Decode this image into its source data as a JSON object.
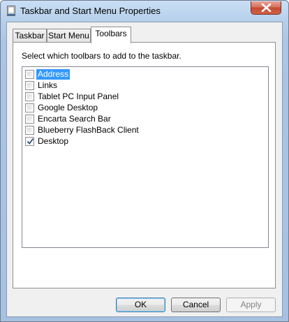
{
  "window": {
    "title": "Taskbar and Start Menu Properties",
    "title_icon": "taskbar-properties-icon",
    "close_icon": "close-icon",
    "close_color": "#c75050"
  },
  "tabs": [
    {
      "label": "Taskbar",
      "active": false
    },
    {
      "label": "Start Menu",
      "active": false
    },
    {
      "label": "Toolbars",
      "active": true
    }
  ],
  "toolbars_panel": {
    "instruction": "Select which toolbars to add to the taskbar.",
    "items": [
      {
        "label": "Address",
        "checked": false,
        "selected": true
      },
      {
        "label": "Links",
        "checked": false,
        "selected": false
      },
      {
        "label": "Tablet PC Input Panel",
        "checked": false,
        "selected": false
      },
      {
        "label": "Google Desktop",
        "checked": false,
        "selected": false
      },
      {
        "label": "Encarta Search Bar",
        "checked": false,
        "selected": false
      },
      {
        "label": "Blueberry FlashBack Client",
        "checked": false,
        "selected": false
      },
      {
        "label": "Desktop",
        "checked": true,
        "selected": false
      }
    ]
  },
  "buttons": {
    "ok": "OK",
    "cancel": "Cancel",
    "apply": "Apply",
    "apply_enabled": false
  },
  "colors": {
    "selection": "#3399ff",
    "title_bar": "#b9d1ea"
  }
}
